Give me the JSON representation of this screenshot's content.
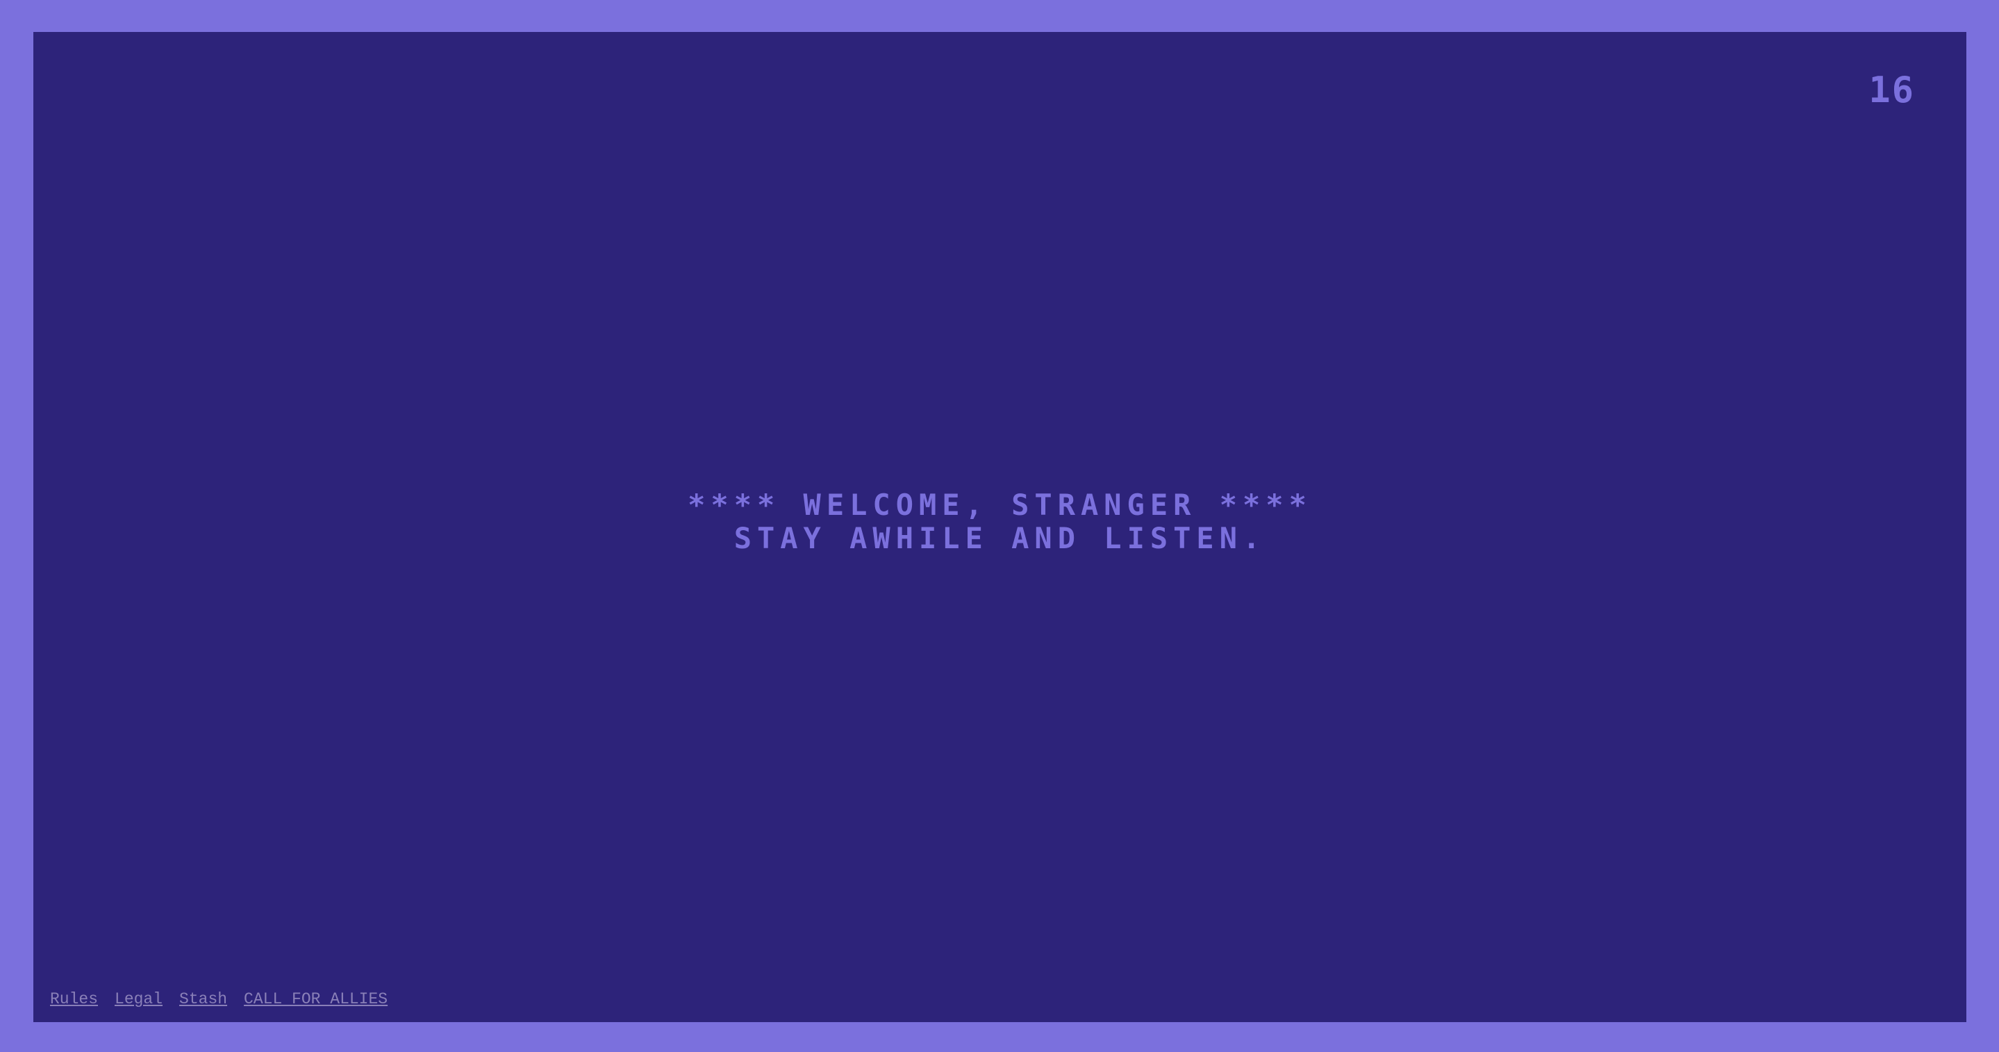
{
  "counter": "16",
  "banner": {
    "line1": "**** WELCOME, STRANGER ****",
    "line2": "STAY AWHILE AND LISTEN."
  },
  "footer": {
    "links": [
      {
        "label": "Rules"
      },
      {
        "label": "Legal"
      },
      {
        "label": "Stash"
      },
      {
        "label": "CALL FOR ALLIES"
      }
    ]
  },
  "colors": {
    "border": "#7b70dd",
    "screen": "#2d237a",
    "text": "#7b70dd",
    "footer_link": "#8a80b8"
  }
}
